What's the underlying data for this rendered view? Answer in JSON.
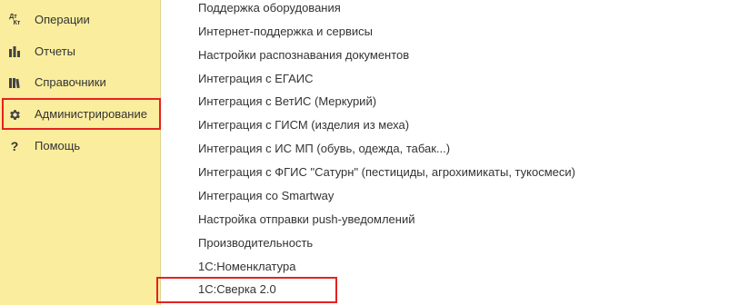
{
  "sidebar": {
    "items": [
      {
        "label": "Операции",
        "icon": "debit-credit-icon"
      },
      {
        "label": "Отчеты",
        "icon": "bar-chart-icon"
      },
      {
        "label": "Справочники",
        "icon": "books-icon"
      },
      {
        "label": "Администрирование",
        "icon": "gear-icon"
      },
      {
        "label": "Помощь",
        "icon": "question-icon"
      }
    ],
    "icon_dk_top": "Дт",
    "icon_dk_bottom": "Кт",
    "icon_question": "?"
  },
  "main": {
    "links": [
      "Поддержка оборудования",
      "Интернет-поддержка и сервисы",
      "Настройки распознавания документов",
      "Интеграция с ЕГАИС",
      "Интеграция с ВетИС (Меркурий)",
      "Интеграция с ГИСМ (изделия из меха)",
      "Интеграция с ИС МП (обувь, одежда, табак...)",
      "Интеграция с ФГИС \"Сатурн\" (пестициды, агрохимикаты, тукосмеси)",
      "Интеграция со Smartway",
      "Настройка отправки push-уведомлений",
      "Производительность",
      "1С:Номенклатура",
      "1С:Сверка 2.0"
    ]
  },
  "colors": {
    "sidebar_bg": "#fbed9e",
    "highlight": "#e52121",
    "text": "#333333"
  }
}
